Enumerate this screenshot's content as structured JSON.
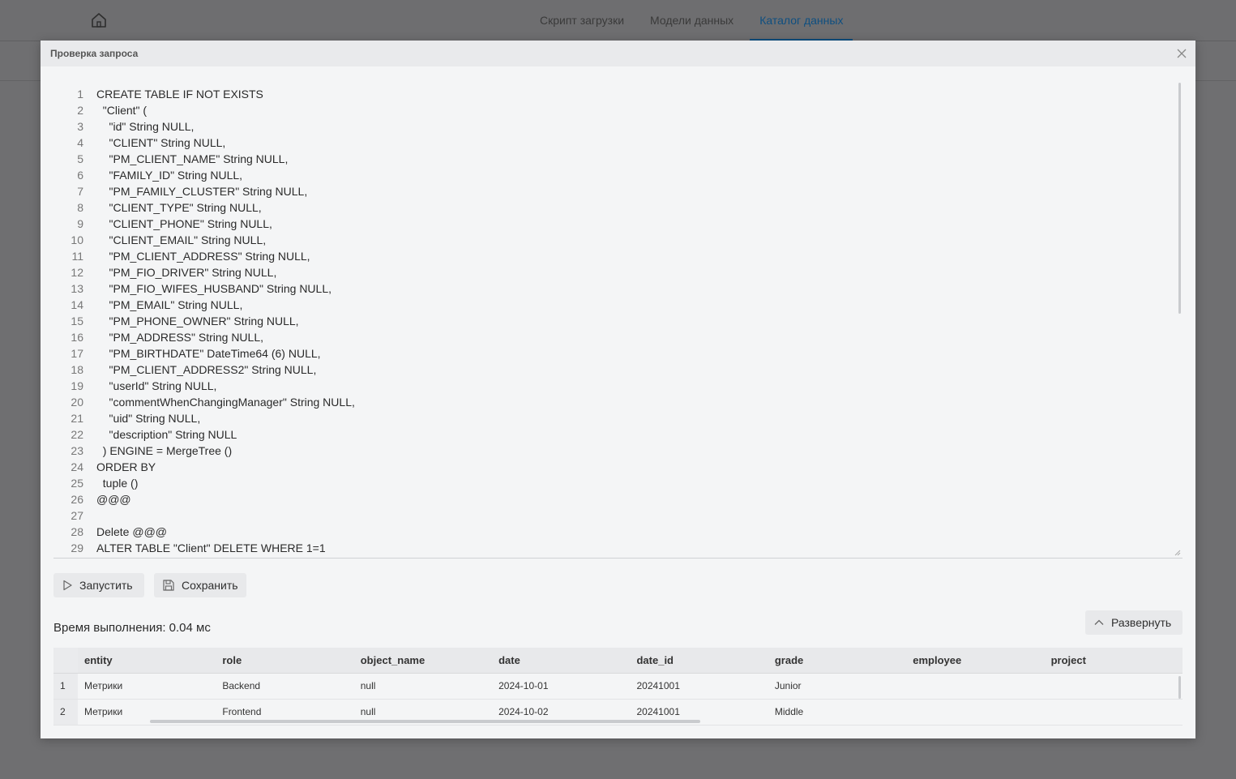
{
  "app": {
    "nav_tabs": [
      {
        "label": "Скрипт загрузки"
      },
      {
        "label": "Модели данных"
      },
      {
        "label": "Каталог данных"
      }
    ],
    "accent_color": "#0f4f80"
  },
  "modal": {
    "title": "Проверка запроса",
    "code_lines": [
      {
        "n": "1",
        "text": "CREATE TABLE IF NOT EXISTS"
      },
      {
        "n": "2",
        "text": "  \"Client\" ("
      },
      {
        "n": "3",
        "text": "    \"id\" String NULL,"
      },
      {
        "n": "4",
        "text": "    \"CLIENT\" String NULL,"
      },
      {
        "n": "5",
        "text": "    \"PM_CLIENT_NAME\" String NULL,"
      },
      {
        "n": "6",
        "text": "    \"FAMILY_ID\" String NULL,"
      },
      {
        "n": "7",
        "text": "    \"PM_FAMILY_CLUSTER\" String NULL,"
      },
      {
        "n": "8",
        "text": "    \"CLIENT_TYPE\" String NULL,"
      },
      {
        "n": "9",
        "text": "    \"CLIENT_PHONE\" String NULL,"
      },
      {
        "n": "10",
        "text": "    \"CLIENT_EMAIL\" String NULL,"
      },
      {
        "n": "11",
        "text": "    \"PM_CLIENT_ADDRESS\" String NULL,"
      },
      {
        "n": "12",
        "text": "    \"PM_FIO_DRIVER\" String NULL,"
      },
      {
        "n": "13",
        "text": "    \"PM_FIO_WIFES_HUSBAND\" String NULL,"
      },
      {
        "n": "14",
        "text": "    \"PM_EMAIL\" String NULL,"
      },
      {
        "n": "15",
        "text": "    \"PM_PHONE_OWNER\" String NULL,"
      },
      {
        "n": "16",
        "text": "    \"PM_ADDRESS\" String NULL,"
      },
      {
        "n": "17",
        "text": "    \"PM_BIRTHDATE\" DateTime64 (6) NULL,"
      },
      {
        "n": "18",
        "text": "    \"PM_CLIENT_ADDRESS2\" String NULL,"
      },
      {
        "n": "19",
        "text": "    \"userId\" String NULL,"
      },
      {
        "n": "20",
        "text": "    \"commentWhenChangingManager\" String NULL,"
      },
      {
        "n": "21",
        "text": "    \"uid\" String NULL,"
      },
      {
        "n": "22",
        "text": "    \"description\" String NULL"
      },
      {
        "n": "23",
        "text": "  ) ENGINE = MergeTree ()"
      },
      {
        "n": "24",
        "text": "ORDER BY"
      },
      {
        "n": "25",
        "text": "  tuple ()"
      },
      {
        "n": "26",
        "text": "@@@"
      },
      {
        "n": "27",
        "text": ""
      },
      {
        "n": "28",
        "text": "Delete @@@"
      },
      {
        "n": "29",
        "text": "ALTER TABLE \"Client\" DELETE WHERE 1=1"
      }
    ],
    "run_label": "Запустить",
    "save_label": "Сохранить",
    "expand_label": "Развернуть",
    "exec_time": "Время выполнения: 0.04 мс",
    "result_table": {
      "columns": [
        "entity",
        "role",
        "object_name",
        "date",
        "date_id",
        "grade",
        "employee",
        "project"
      ],
      "rows": [
        {
          "idx": "1",
          "cells": [
            "Метрики",
            "Backend",
            "null",
            "2024-10-01",
            "20241001",
            "Junior",
            "",
            ""
          ]
        },
        {
          "idx": "2",
          "cells": [
            "Метрики",
            "Frontend",
            "null",
            "2024-10-02",
            "20241001",
            "Middle",
            "",
            ""
          ]
        }
      ]
    }
  }
}
